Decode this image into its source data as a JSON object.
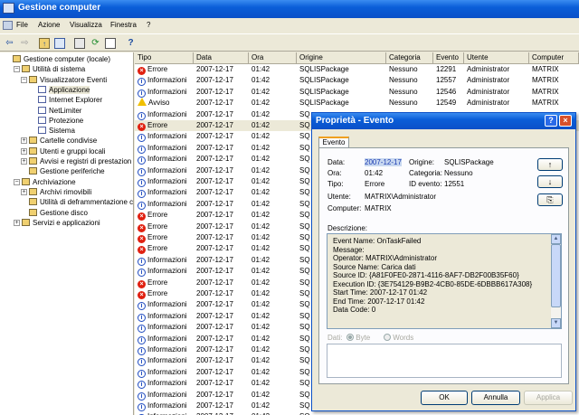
{
  "window": {
    "title": "Gestione computer"
  },
  "menu": [
    "File",
    "Azione",
    "Visualizza",
    "Finestra",
    "?"
  ],
  "toolbar": {
    "icons": [
      "back-arrow-icon",
      "forward-arrow-icon",
      "up-folder-icon",
      "show-hide-tree-icon",
      "properties-icon",
      "refresh-icon",
      "export-list-icon",
      "help-icon"
    ]
  },
  "tree": {
    "nodes": [
      {
        "label": "Gestione computer (locale)",
        "level": 0,
        "icon": "computer-icon",
        "expander": ""
      },
      {
        "label": "Utilità di sistema",
        "level": 1,
        "icon": "tools-icon",
        "expander": "−"
      },
      {
        "label": "Visualizzatore Eventi",
        "level": 2,
        "icon": "event-viewer-icon",
        "expander": "−"
      },
      {
        "label": "Applicazione",
        "level": 3,
        "icon": "log-icon",
        "expander": "",
        "selected": true
      },
      {
        "label": "Internet Explorer",
        "level": 3,
        "icon": "log-icon",
        "expander": ""
      },
      {
        "label": "NetLimiter",
        "level": 3,
        "icon": "log-icon",
        "expander": ""
      },
      {
        "label": "Protezione",
        "level": 3,
        "icon": "log-icon",
        "expander": ""
      },
      {
        "label": "Sistema",
        "level": 3,
        "icon": "log-icon",
        "expander": ""
      },
      {
        "label": "Cartelle condivise",
        "level": 2,
        "icon": "shared-folder-icon",
        "expander": "+"
      },
      {
        "label": "Utenti e gruppi locali",
        "level": 2,
        "icon": "users-icon",
        "expander": "+"
      },
      {
        "label": "Avvisi e registri di prestazion",
        "level": 2,
        "icon": "performance-icon",
        "expander": "+"
      },
      {
        "label": "Gestione periferiche",
        "level": 2,
        "icon": "device-manager-icon",
        "expander": ""
      },
      {
        "label": "Archiviazione",
        "level": 1,
        "icon": "storage-icon",
        "expander": "−"
      },
      {
        "label": "Archivi rimovibili",
        "level": 2,
        "icon": "removable-storage-icon",
        "expander": "+"
      },
      {
        "label": "Utilità di deframmentazione c",
        "level": 2,
        "icon": "defrag-icon",
        "expander": ""
      },
      {
        "label": "Gestione disco",
        "level": 2,
        "icon": "disk-icon",
        "expander": ""
      },
      {
        "label": "Servizi e applicazioni",
        "level": 1,
        "icon": "services-icon",
        "expander": "+"
      }
    ]
  },
  "list": {
    "columns": [
      "Tipo",
      "Data",
      "Ora",
      "Origine",
      "Categoria",
      "Evento",
      "Utente",
      "Computer"
    ],
    "rows": [
      {
        "type": "error",
        "tipo": "Errore",
        "data": "2007-12-17",
        "ora": "01:42",
        "origine": "SQLISPackage",
        "categoria": "Nessuno",
        "evento": "12291",
        "utente": "Administrator",
        "computer": "MATRIX"
      },
      {
        "type": "info",
        "tipo": "Informazioni",
        "data": "2007-12-17",
        "ora": "01:42",
        "origine": "SQLISPackage",
        "categoria": "Nessuno",
        "evento": "12557",
        "utente": "Administrator",
        "computer": "MATRIX"
      },
      {
        "type": "info",
        "tipo": "Informazioni",
        "data": "2007-12-17",
        "ora": "01:42",
        "origine": "SQLISPackage",
        "categoria": "Nessuno",
        "evento": "12546",
        "utente": "Administrator",
        "computer": "MATRIX"
      },
      {
        "type": "warn",
        "tipo": "Avviso",
        "data": "2007-12-17",
        "ora": "01:42",
        "origine": "SQLISPackage",
        "categoria": "Nessuno",
        "evento": "12549",
        "utente": "Administrator",
        "computer": "MATRIX"
      },
      {
        "type": "info",
        "tipo": "Informazioni",
        "data": "2007-12-17",
        "ora": "01:42",
        "origine": "SQ",
        "categoria": "",
        "evento": "",
        "utente": "",
        "computer": ""
      },
      {
        "type": "error",
        "tipo": "Errore",
        "data": "2007-12-17",
        "ora": "01:42",
        "origine": "SQ",
        "categoria": "",
        "evento": "",
        "utente": "",
        "computer": "",
        "selected": true
      },
      {
        "type": "info",
        "tipo": "Informazioni",
        "data": "2007-12-17",
        "ora": "01:42",
        "origine": "SQ",
        "categoria": "",
        "evento": "",
        "utente": "",
        "computer": ""
      },
      {
        "type": "info",
        "tipo": "Informazioni",
        "data": "2007-12-17",
        "ora": "01:42",
        "origine": "SQ",
        "categoria": "",
        "evento": "",
        "utente": "",
        "computer": ""
      },
      {
        "type": "info",
        "tipo": "Informazioni",
        "data": "2007-12-17",
        "ora": "01:42",
        "origine": "SQ",
        "categoria": "",
        "evento": "",
        "utente": "",
        "computer": ""
      },
      {
        "type": "info",
        "tipo": "Informazioni",
        "data": "2007-12-17",
        "ora": "01:42",
        "origine": "SQ",
        "categoria": "",
        "evento": "",
        "utente": "",
        "computer": ""
      },
      {
        "type": "info",
        "tipo": "Informazioni",
        "data": "2007-12-17",
        "ora": "01:42",
        "origine": "SQ",
        "categoria": "",
        "evento": "",
        "utente": "",
        "computer": ""
      },
      {
        "type": "info",
        "tipo": "Informazioni",
        "data": "2007-12-17",
        "ora": "01:42",
        "origine": "SQ",
        "categoria": "",
        "evento": "",
        "utente": "",
        "computer": ""
      },
      {
        "type": "info",
        "tipo": "Informazioni",
        "data": "2007-12-17",
        "ora": "01:42",
        "origine": "SQ",
        "categoria": "",
        "evento": "",
        "utente": "",
        "computer": ""
      },
      {
        "type": "error",
        "tipo": "Errore",
        "data": "2007-12-17",
        "ora": "01:42",
        "origine": "SQ",
        "categoria": "",
        "evento": "",
        "utente": "",
        "computer": ""
      },
      {
        "type": "error",
        "tipo": "Errore",
        "data": "2007-12-17",
        "ora": "01:42",
        "origine": "SQ",
        "categoria": "",
        "evento": "",
        "utente": "",
        "computer": ""
      },
      {
        "type": "error",
        "tipo": "Errore",
        "data": "2007-12-17",
        "ora": "01:42",
        "origine": "SQ",
        "categoria": "",
        "evento": "",
        "utente": "",
        "computer": ""
      },
      {
        "type": "error",
        "tipo": "Errore",
        "data": "2007-12-17",
        "ora": "01:42",
        "origine": "SQ",
        "categoria": "",
        "evento": "",
        "utente": "",
        "computer": ""
      },
      {
        "type": "info",
        "tipo": "Informazioni",
        "data": "2007-12-17",
        "ora": "01:42",
        "origine": "SQ",
        "categoria": "",
        "evento": "",
        "utente": "",
        "computer": ""
      },
      {
        "type": "info",
        "tipo": "Informazioni",
        "data": "2007-12-17",
        "ora": "01:42",
        "origine": "SQ",
        "categoria": "",
        "evento": "",
        "utente": "",
        "computer": ""
      },
      {
        "type": "error",
        "tipo": "Errore",
        "data": "2007-12-17",
        "ora": "01:42",
        "origine": "SQ",
        "categoria": "",
        "evento": "",
        "utente": "",
        "computer": ""
      },
      {
        "type": "error",
        "tipo": "Errore",
        "data": "2007-12-17",
        "ora": "01:42",
        "origine": "SQ",
        "categoria": "",
        "evento": "",
        "utente": "",
        "computer": ""
      },
      {
        "type": "info",
        "tipo": "Informazioni",
        "data": "2007-12-17",
        "ora": "01:42",
        "origine": "SQ",
        "categoria": "",
        "evento": "",
        "utente": "",
        "computer": ""
      },
      {
        "type": "info",
        "tipo": "Informazioni",
        "data": "2007-12-17",
        "ora": "01:42",
        "origine": "SQ",
        "categoria": "",
        "evento": "",
        "utente": "",
        "computer": ""
      },
      {
        "type": "info",
        "tipo": "Informazioni",
        "data": "2007-12-17",
        "ora": "01:42",
        "origine": "SQ",
        "categoria": "",
        "evento": "",
        "utente": "",
        "computer": ""
      },
      {
        "type": "info",
        "tipo": "Informazioni",
        "data": "2007-12-17",
        "ora": "01:42",
        "origine": "SQ",
        "categoria": "",
        "evento": "",
        "utente": "",
        "computer": ""
      },
      {
        "type": "info",
        "tipo": "Informazioni",
        "data": "2007-12-17",
        "ora": "01:42",
        "origine": "SQ",
        "categoria": "",
        "evento": "",
        "utente": "",
        "computer": ""
      },
      {
        "type": "info",
        "tipo": "Informazioni",
        "data": "2007-12-17",
        "ora": "01:42",
        "origine": "SQ",
        "categoria": "",
        "evento": "",
        "utente": "",
        "computer": ""
      },
      {
        "type": "info",
        "tipo": "Informazioni",
        "data": "2007-12-17",
        "ora": "01:42",
        "origine": "SQ",
        "categoria": "",
        "evento": "",
        "utente": "",
        "computer": ""
      },
      {
        "type": "info",
        "tipo": "Informazioni",
        "data": "2007-12-17",
        "ora": "01:42",
        "origine": "SQ",
        "categoria": "",
        "evento": "",
        "utente": "",
        "computer": ""
      },
      {
        "type": "info",
        "tipo": "Informazioni",
        "data": "2007-12-17",
        "ora": "01:42",
        "origine": "SQ",
        "categoria": "",
        "evento": "",
        "utente": "",
        "computer": ""
      },
      {
        "type": "info",
        "tipo": "Informazioni",
        "data": "2007-12-17",
        "ora": "01:42",
        "origine": "SQ",
        "categoria": "",
        "evento": "",
        "utente": "",
        "computer": ""
      },
      {
        "type": "info",
        "tipo": "Informazioni",
        "data": "2007-12-17",
        "ora": "01:42",
        "origine": "SQ",
        "categoria": "",
        "evento": "",
        "utente": "",
        "computer": ""
      },
      {
        "type": "info",
        "tipo": "Informazioni",
        "data": "2007-12-17",
        "ora": "01:42",
        "origine": "SQ",
        "categoria": "",
        "evento": "",
        "utente": "",
        "computer": ""
      }
    ]
  },
  "dialog": {
    "title": "Proprietà - Evento",
    "help_label": "?",
    "close_label": "×",
    "tab": "Evento",
    "fields": {
      "data_label": "Data:",
      "data_value": "2007-12-17",
      "origine_label": "Origine:",
      "origine_value": "SQLISPackage",
      "ora_label": "Ora:",
      "ora_value": "01:42",
      "categoria_label": "Categoria:",
      "categoria_value": "Nessuno",
      "tipo_label": "Tipo:",
      "tipo_value": "Errore",
      "id_label": "ID evento:",
      "id_value": "12551",
      "utente_label": "Utente:",
      "utente_value": "MATRIX\\Administrator",
      "computer_label": "Computer:",
      "computer_value": "MATRIX"
    },
    "nav": {
      "up": "↑",
      "down": "↓",
      "copy": "⎘"
    },
    "descrizione_label": "Descrizione:",
    "description_lines": [
      "Event Name: OnTaskFailed",
      "Message:",
      "Operator: MATRIX\\Administrator",
      "Source Name: Carica dati",
      "Source ID: {A81F0FE0-2871-4116-8AF7-DB2F00B35F60}",
      "Execution ID: {3E754129-B9B2-4CB0-85DE-6DBBB617A308}",
      "Start Time: 2007-12-17 01:42",
      "End Time: 2007-12-17 01:42",
      "Data Code: 0"
    ],
    "dati_label": "Dati:",
    "byte_label": "Byte",
    "words_label": "Words",
    "buttons": {
      "ok": "OK",
      "cancel": "Annulla",
      "apply": "Applica"
    }
  }
}
